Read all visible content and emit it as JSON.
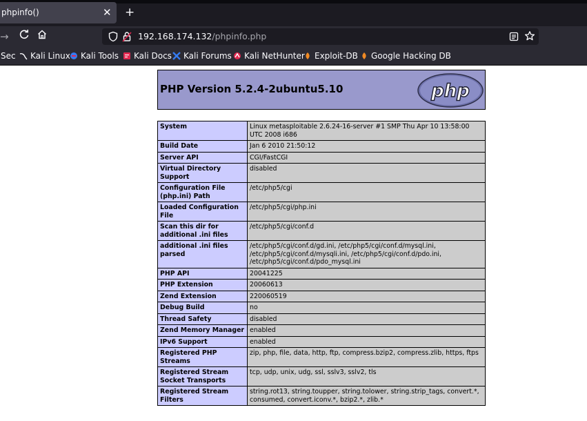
{
  "browser": {
    "tab_title": "phpinfo()",
    "url_host": "192.168.174.132",
    "url_path": "/phpinfo.php",
    "bookmarks": [
      {
        "label": "Sec",
        "icon": "none"
      },
      {
        "label": "Kali Linux",
        "icon": "kali-dragon-icon"
      },
      {
        "label": "Kali Tools",
        "icon": "kali-tools-icon"
      },
      {
        "label": "Kali Docs",
        "icon": "kali-docs-icon"
      },
      {
        "label": "Kali Forums",
        "icon": "kali-forums-icon"
      },
      {
        "label": "Kali NetHunter",
        "icon": "nethunter-icon"
      },
      {
        "label": "Exploit-DB",
        "icon": "exploit-db-icon"
      },
      {
        "label": "Google Hacking DB",
        "icon": "ghdb-icon"
      }
    ]
  },
  "page": {
    "version_title": "PHP Version 5.2.4-2ubuntu5.10",
    "logo_text": "php",
    "rows": [
      {
        "key": "System",
        "value": "Linux metasploitable 2.6.24-16-server #1 SMP Thu Apr 10 13:58:00 UTC 2008 i686"
      },
      {
        "key": "Build Date",
        "value": "Jan 6 2010 21:50:12"
      },
      {
        "key": "Server API",
        "value": "CGI/FastCGI"
      },
      {
        "key": "Virtual Directory Support",
        "value": "disabled"
      },
      {
        "key": "Configuration File (php.ini) Path",
        "value": "/etc/php5/cgi"
      },
      {
        "key": "Loaded Configuration File",
        "value": "/etc/php5/cgi/php.ini"
      },
      {
        "key": "Scan this dir for additional .ini files",
        "value": "/etc/php5/cgi/conf.d"
      },
      {
        "key": "additional .ini files parsed",
        "value": "/etc/php5/cgi/conf.d/gd.ini, /etc/php5/cgi/conf.d/mysql.ini, /etc/php5/cgi/conf.d/mysqli.ini, /etc/php5/cgi/conf.d/pdo.ini, /etc/php5/cgi/conf.d/pdo_mysql.ini"
      },
      {
        "key": "PHP API",
        "value": "20041225"
      },
      {
        "key": "PHP Extension",
        "value": "20060613"
      },
      {
        "key": "Zend Extension",
        "value": "220060519"
      },
      {
        "key": "Debug Build",
        "value": "no"
      },
      {
        "key": "Thread Safety",
        "value": "disabled"
      },
      {
        "key": "Zend Memory Manager",
        "value": "enabled"
      },
      {
        "key": "IPv6 Support",
        "value": "enabled"
      },
      {
        "key": "Registered PHP Streams",
        "value": "zip, php, file, data, http, ftp, compress.bzip2, compress.zlib, https, ftps"
      },
      {
        "key": "Registered Stream Socket Transports",
        "value": "tcp, udp, unix, udg, ssl, sslv3, sslv2, tls"
      },
      {
        "key": "Registered Stream Filters",
        "value": "string.rot13, string.toupper, string.tolower, string.strip_tags, convert.*, consumed, convert.iconv.*, bzip2.*, zlib.*"
      }
    ]
  },
  "colors": {
    "header_bg": "#9999cc",
    "key_bg": "#ccccff",
    "value_bg": "#cccccc",
    "toolbar_bg": "#2b2a33",
    "tabbar_bg": "#1c1b22"
  }
}
